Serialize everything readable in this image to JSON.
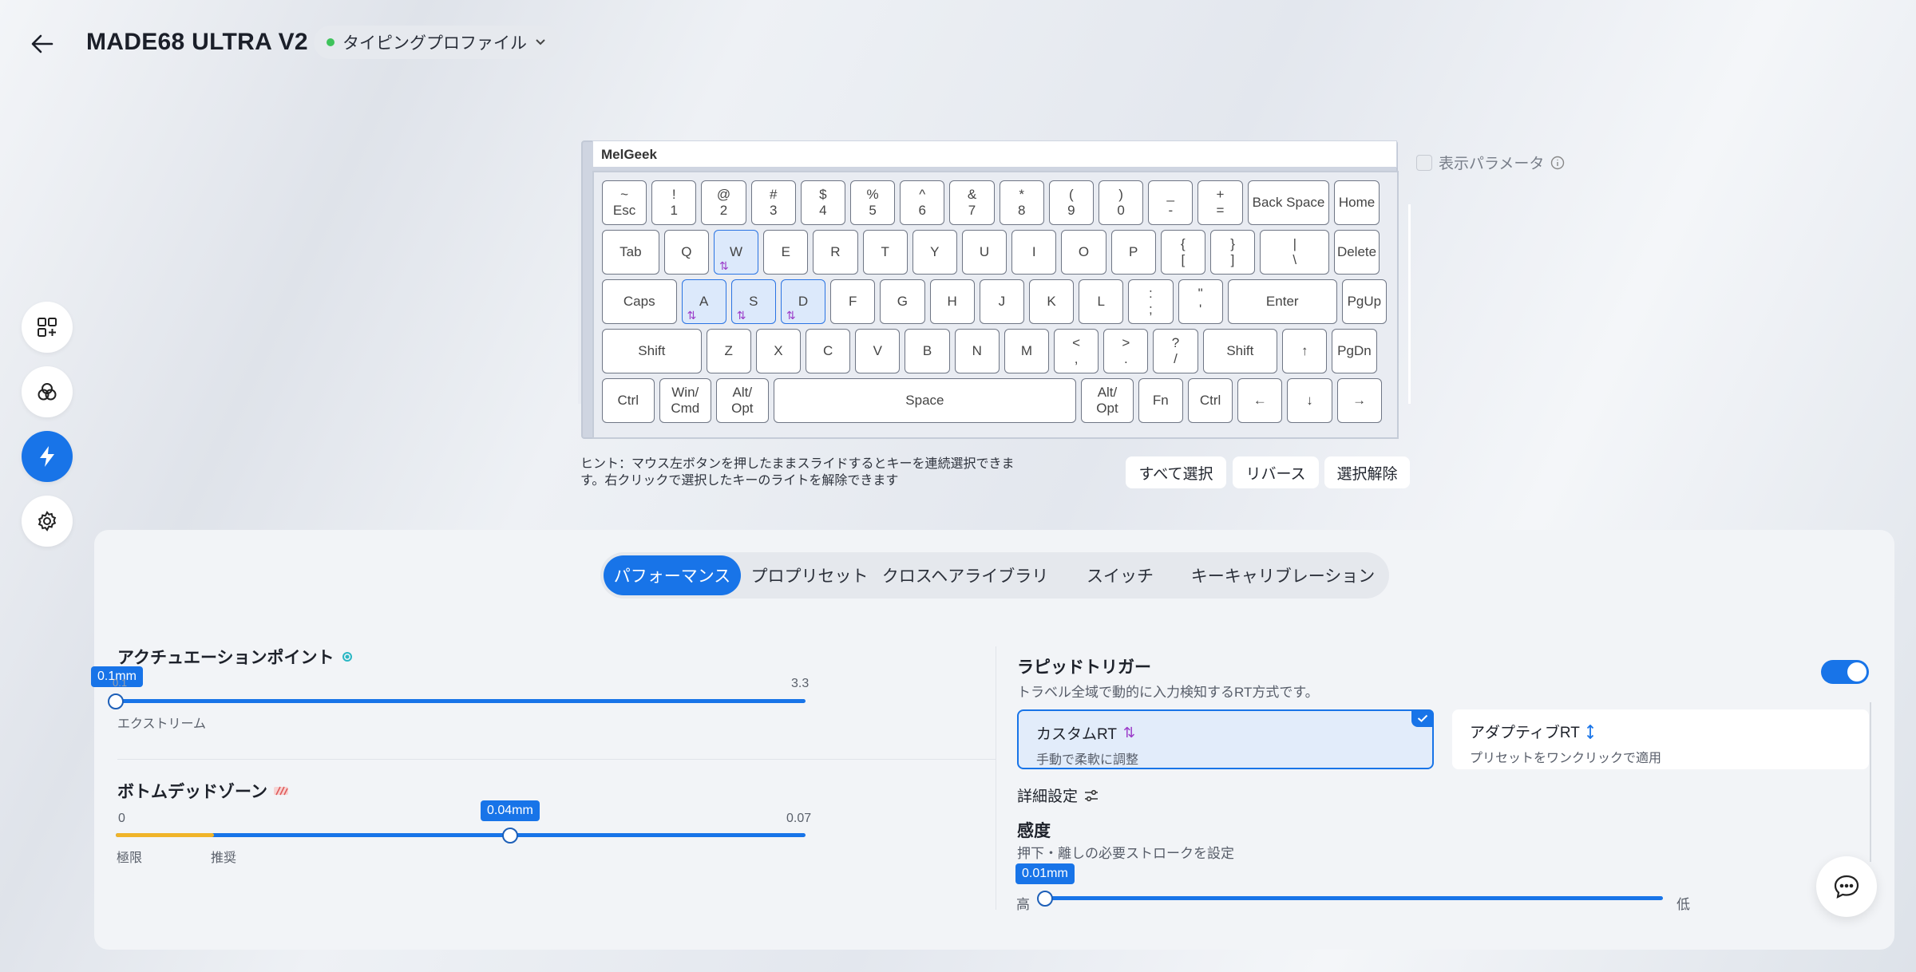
{
  "header": {
    "title": "MADE68 ULTRA V2",
    "profile_label": "タイピングプロファイル"
  },
  "keyboard": {
    "brand": "MelGeek",
    "rows": [
      [
        {
          "top": "~",
          "bot": "Esc"
        },
        {
          "top": "!",
          "bot": "1"
        },
        {
          "top": "@",
          "bot": "2"
        },
        {
          "top": "#",
          "bot": "3"
        },
        {
          "top": "$",
          "bot": "4"
        },
        {
          "top": "%",
          "bot": "5"
        },
        {
          "top": "^",
          "bot": "6"
        },
        {
          "top": "&",
          "bot": "7"
        },
        {
          "top": "*",
          "bot": "8"
        },
        {
          "top": "(",
          "bot": "9"
        },
        {
          "top": ")",
          "bot": "0"
        },
        {
          "top": "_",
          "bot": "-"
        },
        {
          "top": "+",
          "bot": "="
        },
        {
          "top": "",
          "bot": "Back Space"
        },
        {
          "top": "",
          "bot": "Home"
        }
      ],
      [
        {
          "top": "",
          "bot": "Tab"
        },
        {
          "top": "",
          "bot": "Q"
        },
        {
          "top": "",
          "bot": "W",
          "sel": true
        },
        {
          "top": "",
          "bot": "E"
        },
        {
          "top": "",
          "bot": "R"
        },
        {
          "top": "",
          "bot": "T"
        },
        {
          "top": "",
          "bot": "Y"
        },
        {
          "top": "",
          "bot": "U"
        },
        {
          "top": "",
          "bot": "I"
        },
        {
          "top": "",
          "bot": "O"
        },
        {
          "top": "",
          "bot": "P"
        },
        {
          "top": "{",
          "bot": "["
        },
        {
          "top": "}",
          "bot": "]"
        },
        {
          "top": "|",
          "bot": "\\"
        },
        {
          "top": "",
          "bot": "Delete"
        }
      ],
      [
        {
          "top": "",
          "bot": "Caps"
        },
        {
          "top": "",
          "bot": "A",
          "sel": true
        },
        {
          "top": "",
          "bot": "S",
          "sel": true
        },
        {
          "top": "",
          "bot": "D",
          "sel": true
        },
        {
          "top": "",
          "bot": "F"
        },
        {
          "top": "",
          "bot": "G"
        },
        {
          "top": "",
          "bot": "H"
        },
        {
          "top": "",
          "bot": "J"
        },
        {
          "top": "",
          "bot": "K"
        },
        {
          "top": "",
          "bot": "L"
        },
        {
          "top": ":",
          "bot": ";"
        },
        {
          "top": "\"",
          "bot": "'"
        },
        {
          "top": "",
          "bot": "Enter"
        },
        {
          "top": "",
          "bot": "PgUp"
        }
      ],
      [
        {
          "top": "",
          "bot": "Shift"
        },
        {
          "top": "",
          "bot": "Z"
        },
        {
          "top": "",
          "bot": "X"
        },
        {
          "top": "",
          "bot": "C"
        },
        {
          "top": "",
          "bot": "V"
        },
        {
          "top": "",
          "bot": "B"
        },
        {
          "top": "",
          "bot": "N"
        },
        {
          "top": "",
          "bot": "M"
        },
        {
          "top": "<",
          "bot": ","
        },
        {
          "top": ">",
          "bot": "."
        },
        {
          "top": "?",
          "bot": "/"
        },
        {
          "top": "",
          "bot": "Shift"
        },
        {
          "top": "",
          "bot": "↑"
        },
        {
          "top": "",
          "bot": "PgDn"
        }
      ],
      [
        {
          "top": "",
          "bot": "Ctrl"
        },
        {
          "top": "Win/",
          "bot": "Cmd"
        },
        {
          "top": "Alt/",
          "bot": "Opt"
        },
        {
          "top": "",
          "bot": "Space"
        },
        {
          "top": "Alt/",
          "bot": "Opt"
        },
        {
          "top": "",
          "bot": "Fn"
        },
        {
          "top": "",
          "bot": "Ctrl"
        },
        {
          "top": "",
          "bot": "←"
        },
        {
          "top": "",
          "bot": "↓"
        },
        {
          "top": "",
          "bot": "→"
        }
      ]
    ],
    "rt_glyph": "⇅",
    "show_params_label": "表示パラメータ",
    "hint": "ヒント：マウス左ボタンを押したままスライドするとキーを連続選択できます。右クリックで選択したキーのライトを解除できます",
    "actions": {
      "select_all": "すべて選択",
      "reverse": "リバース",
      "deselect": "選択解除"
    }
  },
  "tabs": [
    "パフォーマンス",
    "プロプリセット",
    "クロスヘアライブラリ",
    "スイッチ",
    "キーキャリブレーション"
  ],
  "actuation": {
    "title": "アクチュエーションポイント",
    "value": "0.1mm",
    "min_label": "0.1",
    "max_label": "3.3",
    "mode_label": "エクストリーム",
    "value_num": 0.1
  },
  "bottom_deadzone": {
    "title": "ボトムデッドゾーン",
    "value": "0.04mm",
    "min_label": "0",
    "max_label": "0.07",
    "left_label": "極限",
    "right_label": "推奨",
    "value_num": 0.04,
    "recommended_num": 0.01
  },
  "rapid_trigger": {
    "title": "ラピッドトリガー",
    "desc": "トラベル全域で動的に入力検知するRT方式です。",
    "enabled": true,
    "custom": {
      "title": "カスタムRT",
      "desc": "手動で柔軟に調整"
    },
    "adaptive": {
      "title": "アダプティブRT",
      "desc": "プリセットをワンクリックで適用"
    },
    "advanced_label": "詳細設定",
    "sensitivity": {
      "title": "感度",
      "desc": "押下・離しの必要ストロークを設定",
      "value": "0.01mm",
      "high_label": "高",
      "low_label": "低",
      "value_num": 0.01
    }
  },
  "colors": {
    "accent": "#1874e8",
    "selected_key": "#dce9fb",
    "rt_icon": "#9b3cc9",
    "status_green": "#3ec35b",
    "recommended": "#f0b429"
  }
}
